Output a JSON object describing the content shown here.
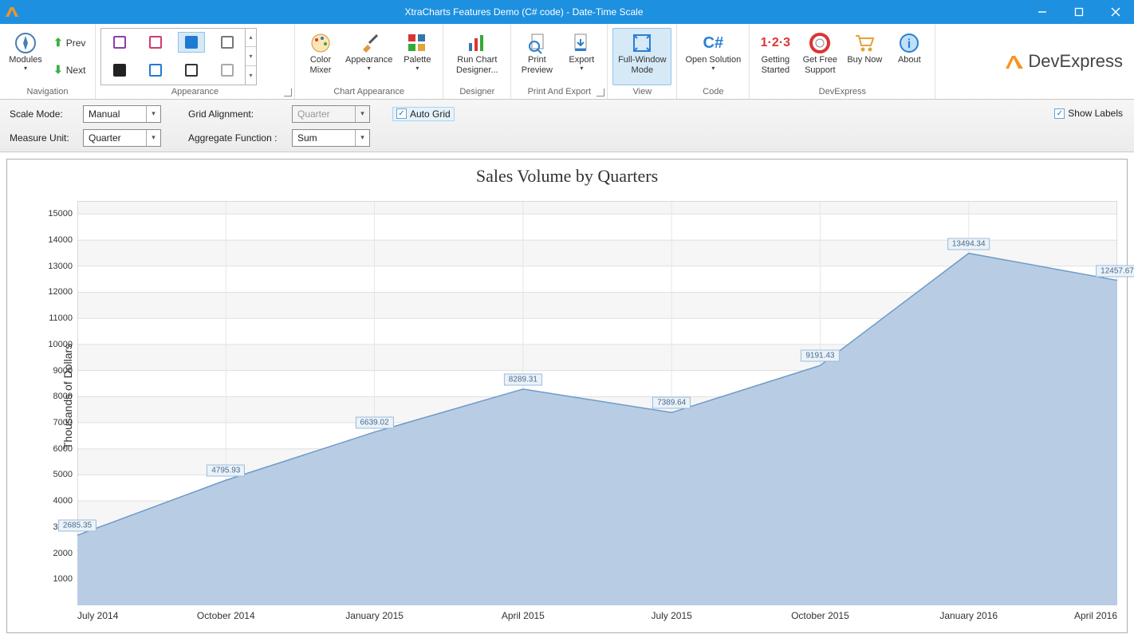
{
  "window": {
    "title": "XtraCharts Features Demo (C# code) - Date-Time Scale"
  },
  "ribbon": {
    "groups": {
      "navigation": {
        "label": "Navigation",
        "modules": "Modules",
        "prev": "Prev",
        "next": "Next"
      },
      "appearance": {
        "label": "Appearance"
      },
      "chart_appearance": {
        "label": "Chart Appearance",
        "color_mixer": "Color\nMixer",
        "appearance": "Appearance",
        "palette": "Palette"
      },
      "designer": {
        "label": "Designer",
        "run": "Run Chart\nDesigner..."
      },
      "print_export": {
        "label": "Print And Export",
        "preview": "Print\nPreview",
        "export": "Export"
      },
      "view": {
        "label": "View",
        "full_window": "Full-Window\nMode"
      },
      "code": {
        "label": "Code",
        "open_solution": "Open Solution"
      },
      "devexpress": {
        "label": "DevExpress",
        "getting_started": "Getting\nStarted",
        "support": "Get Free\nSupport",
        "buy": "Buy Now",
        "about": "About"
      }
    },
    "brand": "DevExpress"
  },
  "options": {
    "scale_mode_label": "Scale Mode:",
    "scale_mode_value": "Manual",
    "grid_alignment_label": "Grid Alignment:",
    "grid_alignment_value": "Quarter",
    "auto_grid_label": "Auto Grid",
    "auto_grid_checked": true,
    "measure_unit_label": "Measure Unit:",
    "measure_unit_value": "Quarter",
    "aggregate_label": "Aggregate Function :",
    "aggregate_value": "Sum",
    "show_labels_label": "Show Labels",
    "show_labels_checked": true
  },
  "chart_data": {
    "type": "area",
    "title": "Sales Volume by Quarters",
    "ylabel": "Thousands of Dollars",
    "xlabel": "",
    "ylim": [
      0,
      15500
    ],
    "yticks": [
      1000,
      2000,
      3000,
      4000,
      5000,
      6000,
      7000,
      8000,
      9000,
      10000,
      11000,
      12000,
      13000,
      14000,
      15000
    ],
    "categories": [
      "July 2014",
      "October 2014",
      "January 2015",
      "April 2015",
      "July 2015",
      "October 2015",
      "January 2016",
      "April 2016"
    ],
    "values": [
      2685.35,
      4795.93,
      6639.02,
      8289.31,
      7389.64,
      9191.43,
      13494.34,
      12457.67
    ],
    "series_color": "#b8cde4",
    "series_border": "#6f9bc7",
    "label_fill": "#eaf2fa",
    "label_border": "#9cbcd9"
  }
}
